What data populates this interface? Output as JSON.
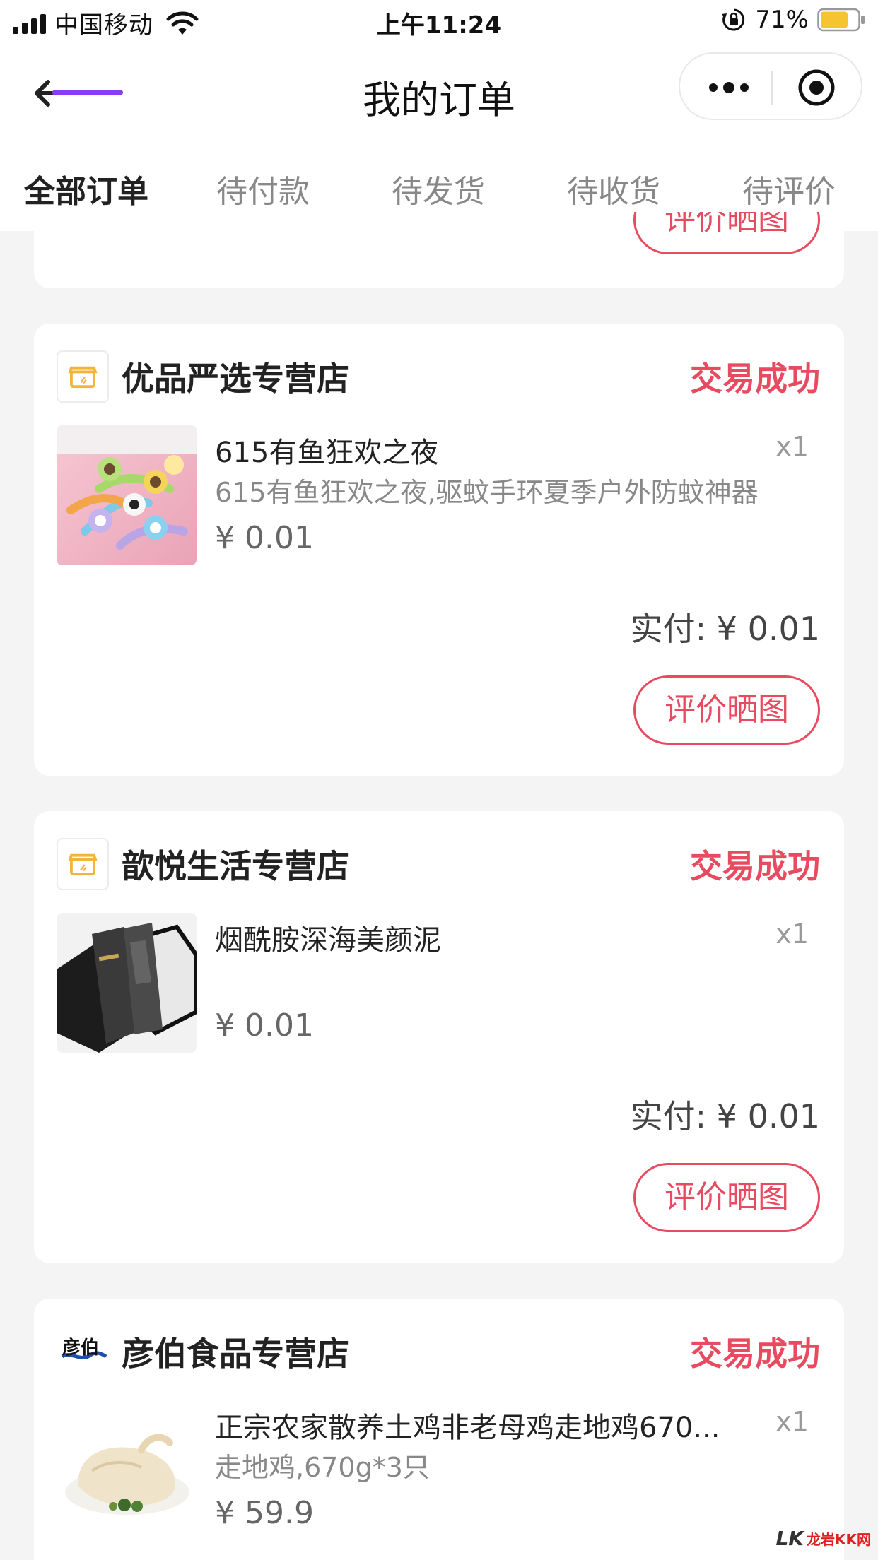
{
  "status_bar": {
    "carrier": "中国移动",
    "time": "上午11:24",
    "battery": "71%"
  },
  "nav": {
    "title": "我的订单"
  },
  "tabs": [
    {
      "label": "全部订单"
    },
    {
      "label": "待付款"
    },
    {
      "label": "待发货"
    },
    {
      "label": "待收货"
    },
    {
      "label": "待评价"
    }
  ],
  "partial_card": {
    "button_label": "评价晒图"
  },
  "orders": [
    {
      "store": "优品严选专营店",
      "status": "交易成功",
      "product_title": "615有鱼狂欢之夜",
      "product_sub": "615有鱼狂欢之夜,驱蚊手环夏季户外防蚊神器",
      "price": "¥ 0.01",
      "qty": "x1",
      "paid": "实付: ¥ 0.01",
      "button": "评价晒图"
    },
    {
      "store": "歆悦生活专营店",
      "status": "交易成功",
      "product_title": "烟酰胺深海美颜泥",
      "product_sub": "",
      "price": "¥ 0.01",
      "qty": "x1",
      "paid": "实付: ¥ 0.01",
      "button": "评价晒图"
    },
    {
      "store": "彦伯食品专营店",
      "status": "交易成功",
      "product_title": "正宗农家散养土鸡非老母鸡走地鸡670...",
      "product_sub": "走地鸡,670g*3只",
      "price": "¥ 59.9",
      "qty": "x1"
    }
  ],
  "watermark": {
    "text": "龙岩KK网"
  },
  "colors": {
    "accent": "#e84a5f",
    "tab_indicator": "#8a3df0",
    "background": "#f4f4f4"
  }
}
